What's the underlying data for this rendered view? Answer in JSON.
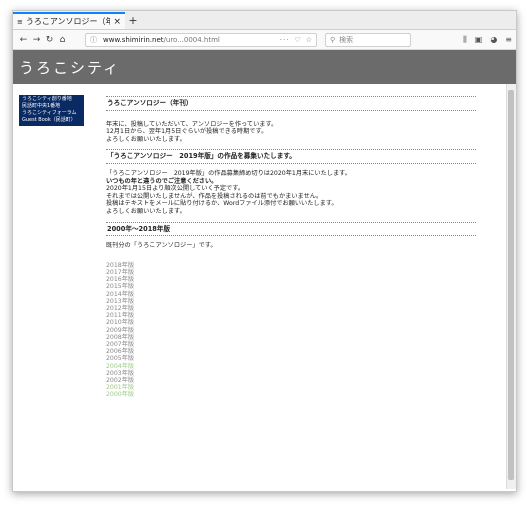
{
  "browser": {
    "tab_title": "うろこアンソロジー（年",
    "tab_close": "×",
    "new_tab": "+",
    "url_host": "www.shimirin.net",
    "url_path": "/uro...0004.html",
    "url_more": "···",
    "search_placeholder": "検索"
  },
  "site": {
    "title": "うろこシティ"
  },
  "sidebar": {
    "items": [
      {
        "label": "うろこシティ創り番地"
      },
      {
        "label": "民話町中央1番地"
      },
      {
        "label": "うろこシティフォーラム"
      },
      {
        "label": "Guest Book（民話町）"
      }
    ]
  },
  "content": {
    "s1_title": "うろこアンソロジー（年刊）",
    "s1_p1": "年末に、投稿していただいて、アンソロジーを作っています。",
    "s1_p2": "12月1日から、翌年1月5日ぐらいが投稿できる時期です。",
    "s1_p3": "よろしくお願いいたします。",
    "s2_title": "「うろこアンソロジー　2019年版」の作品を募集いたします。",
    "s2_p1": "「うろこアンソロジー　2019年版」の作品募集締め切りは2020年1月末にいたします。",
    "s2_p2": "いつもの年と違うのでご注意ください。",
    "s2_p3": "2020年1月15日より順次公開していく予定です。",
    "s2_p4": "それまでは公開いたしませんが、作品を投稿されるのは前でもかまいません。",
    "s2_p5": "投稿はテキストをメールに貼り付けるか、Wordファイル添付でお願いいたします。",
    "s2_p6": "よろしくお願いいたします。",
    "s3_title": "2000年〜2018年版",
    "s3_p1": "既刊分の「うろこアンソロジー」です。",
    "years": [
      {
        "label": "2018年版",
        "visited": false
      },
      {
        "label": "2017年版",
        "visited": false
      },
      {
        "label": "2016年版",
        "visited": false
      },
      {
        "label": "2015年版",
        "visited": false
      },
      {
        "label": "2014年版",
        "visited": false
      },
      {
        "label": "2013年版",
        "visited": false
      },
      {
        "label": "2012年版",
        "visited": false
      },
      {
        "label": "2011年版",
        "visited": false
      },
      {
        "label": "2010年版",
        "visited": false
      },
      {
        "label": "2009年版",
        "visited": false
      },
      {
        "label": "2008年版",
        "visited": false
      },
      {
        "label": "2007年版",
        "visited": false
      },
      {
        "label": "2006年版",
        "visited": false
      },
      {
        "label": "2005年版",
        "visited": false
      },
      {
        "label": "2004年版",
        "visited": true
      },
      {
        "label": "2003年版",
        "visited": false
      },
      {
        "label": "2002年版",
        "visited": false
      },
      {
        "label": "2001年版",
        "visited": true
      },
      {
        "label": "2000年版",
        "visited": true
      }
    ]
  }
}
